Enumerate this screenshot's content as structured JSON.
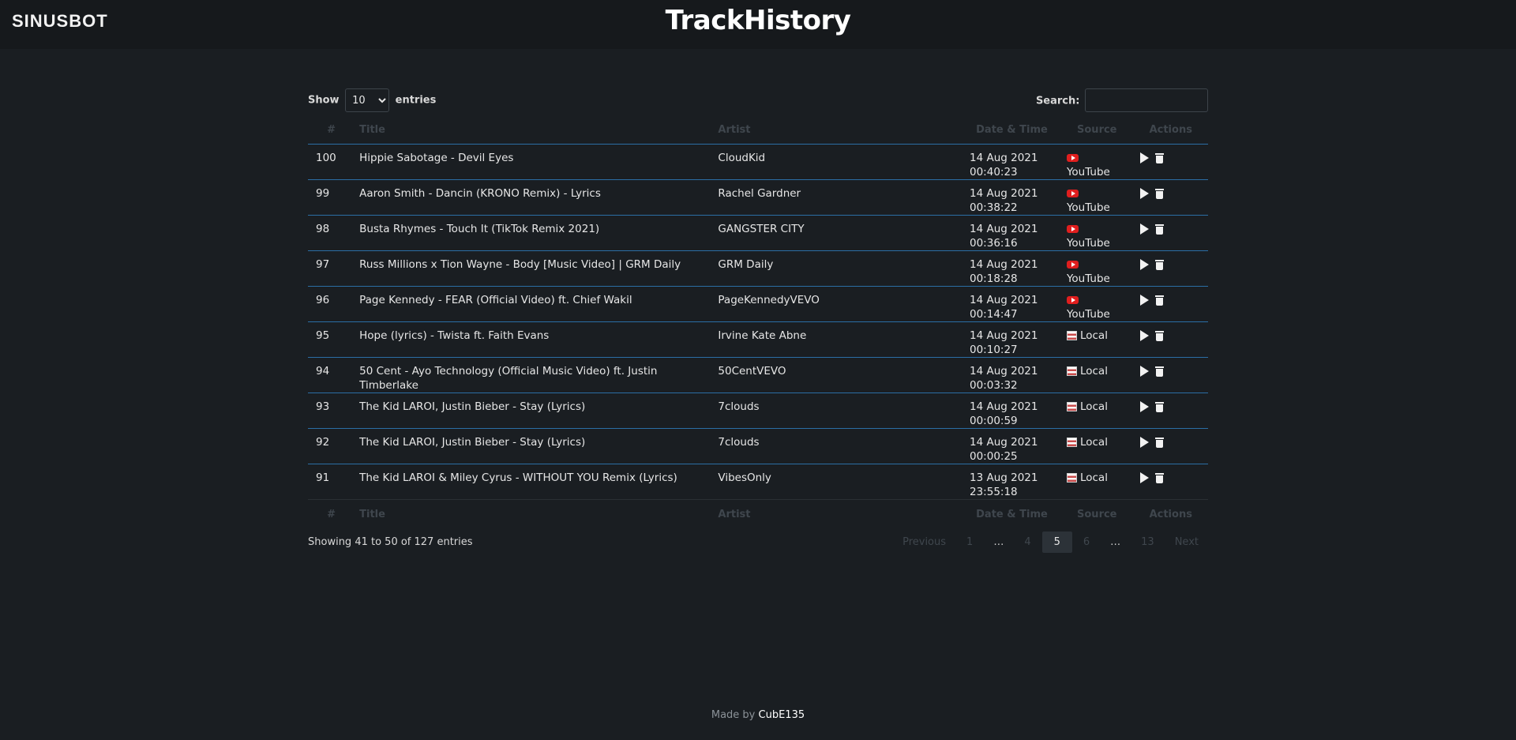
{
  "header": {
    "logo": "SINUSBOT",
    "title": "TrackHistory"
  },
  "controls": {
    "show_label": "Show",
    "entries_label": "entries",
    "page_length": "10",
    "search_label": "Search:",
    "search_value": ""
  },
  "columns": [
    "#",
    "Title",
    "Artist",
    "Date & Time",
    "Source",
    "Actions"
  ],
  "rows": [
    {
      "num": "100",
      "title": "Hippie Sabotage - Devil Eyes",
      "artist": "CloudKid",
      "date": "14 Aug 2021",
      "time": "00:40:23",
      "source": "YouTube",
      "source_icon": "youtube-icon"
    },
    {
      "num": "99",
      "title": "Aaron Smith - Dancin (KRONO Remix) - Lyrics",
      "artist": "Rachel Gardner",
      "date": "14 Aug 2021",
      "time": "00:38:22",
      "source": "YouTube",
      "source_icon": "youtube-icon"
    },
    {
      "num": "98",
      "title": "Busta Rhymes - Touch It (TikTok Remix 2021)",
      "artist": "GANGSTER CITY",
      "date": "14 Aug 2021",
      "time": "00:36:16",
      "source": "YouTube",
      "source_icon": "youtube-icon"
    },
    {
      "num": "97",
      "title": "Russ Millions x Tion Wayne - Body [Music Video] | GRM Daily",
      "artist": "GRM Daily",
      "date": "14 Aug 2021",
      "time": "00:18:28",
      "source": "YouTube",
      "source_icon": "youtube-icon"
    },
    {
      "num": "96",
      "title": "Page Kennedy - FEAR (Official Video) ft. Chief Wakil",
      "artist": "PageKennedyVEVO",
      "date": "14 Aug 2021",
      "time": "00:14:47",
      "source": "YouTube",
      "source_icon": "youtube-icon"
    },
    {
      "num": "95",
      "title": "Hope (lyrics) - Twista ft. Faith Evans",
      "artist": "Irvine Kate Abne",
      "date": "14 Aug 2021",
      "time": "00:10:27",
      "source": "Local",
      "source_icon": "local-file-icon"
    },
    {
      "num": "94",
      "title": "50 Cent - Ayo Technology (Official Music Video) ft. Justin Timberlake",
      "artist": "50CentVEVO",
      "date": "14 Aug 2021",
      "time": "00:03:32",
      "source": "Local",
      "source_icon": "local-file-icon"
    },
    {
      "num": "93",
      "title": "The Kid LAROI, Justin Bieber - Stay (Lyrics)",
      "artist": "7clouds",
      "date": "14 Aug 2021",
      "time": "00:00:59",
      "source": "Local",
      "source_icon": "local-file-icon"
    },
    {
      "num": "92",
      "title": "The Kid LAROI, Justin Bieber - Stay (Lyrics)",
      "artist": "7clouds",
      "date": "14 Aug 2021",
      "time": "00:00:25",
      "source": "Local",
      "source_icon": "local-file-icon"
    },
    {
      "num": "91",
      "title": "The Kid LAROI & Miley Cyrus - WITHOUT YOU Remix (Lyrics)",
      "artist": "VibesOnly",
      "date": "13 Aug 2021",
      "time": "23:55:18",
      "source": "Local",
      "source_icon": "local-file-icon"
    }
  ],
  "info": "Showing 41 to 50 of 127 entries",
  "pagination": {
    "previous": "Previous",
    "pages": [
      "1",
      "…",
      "4",
      "5",
      "6",
      "…",
      "13"
    ],
    "current": "5",
    "next": "Next"
  },
  "footer": {
    "made_by_label": "Made by",
    "author": "CubE135"
  },
  "colors": {
    "background": "#1a1e22",
    "row_border": "#2b6ea5",
    "youtube": "#e01e1e"
  }
}
